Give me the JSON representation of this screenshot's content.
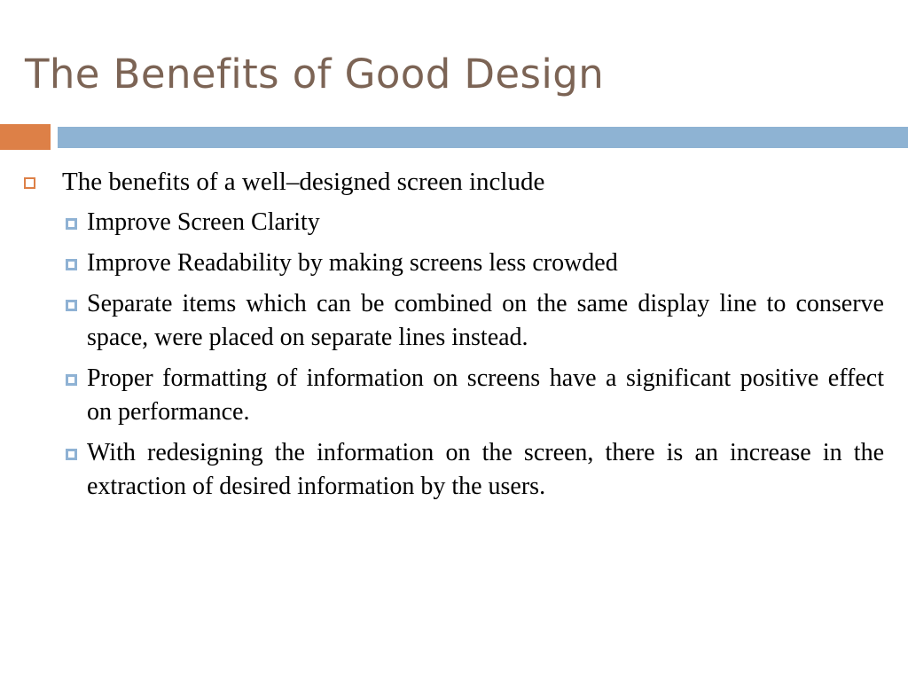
{
  "slide": {
    "title": "The Benefits of Good Design",
    "background_color": "#ffffff",
    "title_color": "#7c6455",
    "accent_color": "#dd8047",
    "bar_color": "#8eb3d3",
    "body_text_color": "#000000"
  },
  "divider": {
    "accent_name": "orange-accent-block",
    "bar_name": "blue-divider-bar"
  },
  "content": {
    "level1": [
      {
        "text": "The benefits of a well–designed screen include",
        "bullet_glyph": "hollow-square",
        "bullet_color": "#dd8047"
      }
    ],
    "level2": [
      {
        "text": "Improve Screen Clarity",
        "bullet_glyph": "square-outline-filled",
        "bullet_color": "#8fb2d4",
        "wraps": false
      },
      {
        "text": "Improve Readability by making screens less crowded",
        "bullet_glyph": "square-outline-filled",
        "bullet_color": "#8fb2d4",
        "wraps": false
      },
      {
        "text": "Separate items which can be combined on the same display line to conserve space, were placed on separate lines instead.",
        "bullet_glyph": "square-outline-filled",
        "bullet_color": "#8fb2d4",
        "wraps": true
      },
      {
        "text": "Proper formatting of information on screens have a significant positive effect on performance.",
        "bullet_glyph": "square-outline-filled",
        "bullet_color": "#8fb2d4",
        "wraps": true
      },
      {
        "text": "With redesigning the information on the screen, there is an increase in the extraction of desired information by the users.",
        "bullet_glyph": "square-outline-filled",
        "bullet_color": "#8fb2d4",
        "wraps": true
      }
    ]
  }
}
